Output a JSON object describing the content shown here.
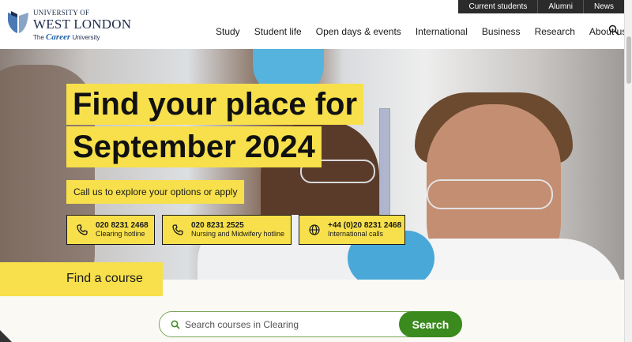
{
  "utility_links": [
    "Current students",
    "Alumni",
    "News"
  ],
  "logo": {
    "line1": "UNIVERSITY OF",
    "line2": "WEST LONDON",
    "tag_pre": "The",
    "tag_em": "Career",
    "tag_post": "University"
  },
  "nav": {
    "items": [
      "Study",
      "Student life",
      "Open days & events",
      "International",
      "Business",
      "Research",
      "About us"
    ]
  },
  "hero": {
    "headline_line1": "Find your place for",
    "headline_line2": "September 2024",
    "sub_cta": "Call us to explore your options or apply",
    "phones": [
      {
        "number": "020 8231 2468",
        "label": "Clearing hotline",
        "icon": "phone-icon"
      },
      {
        "number": "020 8231 2525",
        "label": "Nursing and Midwifery hotline",
        "icon": "phone-icon"
      },
      {
        "number": "+44 (0)20 8231 2468",
        "label": "International calls",
        "icon": "globe-icon"
      }
    ]
  },
  "find_course": {
    "title": "Find a course",
    "placeholder": "Search courses in Clearing",
    "button": "Search"
  },
  "colors": {
    "accent_yellow": "#f7e04b",
    "search_green": "#3a8a1e",
    "utility_bar": "#2b2b2b",
    "brand_navy": "#1d2d4e"
  }
}
